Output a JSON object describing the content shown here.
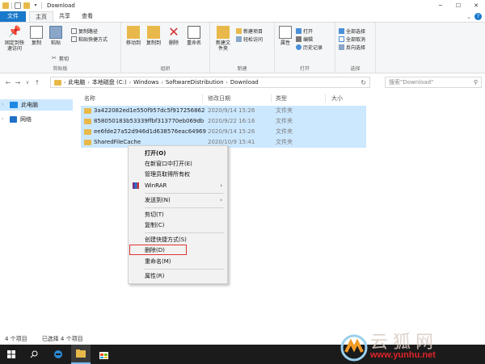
{
  "window": {
    "title": "Download"
  },
  "tabs": [
    "文件",
    "主页",
    "共享",
    "查看"
  ],
  "ribbon": {
    "clipboard": {
      "label": "剪贴板",
      "pin": "固定到快速访问",
      "copy": "复制",
      "paste": "粘贴",
      "copy_path": "复制路径",
      "paste_shortcut": "粘贴快捷方式",
      "cut": "剪切"
    },
    "organize": {
      "label": "组织",
      "move_to": "移动到",
      "copy_to": "复制到",
      "delete": "删除",
      "rename": "重命名"
    },
    "new": {
      "label": "新建",
      "new_folder": "新建文件夹",
      "new_item": "新建项目",
      "easy_access": "轻松访问"
    },
    "open": {
      "label": "打开",
      "properties": "属性",
      "open": "打开",
      "edit": "编辑",
      "history": "历史记录"
    },
    "select": {
      "label": "选择",
      "select_all": "全部选择",
      "select_none": "全部取消",
      "invert": "反向选择"
    }
  },
  "address": {
    "crumbs": [
      "此电脑",
      "本地磁盘 (C:)",
      "Windows",
      "SoftwareDistribution",
      "Download"
    ],
    "search_placeholder": "搜索\"Download\""
  },
  "sidebar": {
    "items": [
      "此电脑",
      "网络"
    ]
  },
  "columns": {
    "name": "名称",
    "date": "修改日期",
    "type": "类型",
    "size": "大小"
  },
  "files": [
    {
      "name": "3a422082ed1e550f957dc5f917256862",
      "date": "2020/9/14 15:26",
      "type": "文件夹"
    },
    {
      "name": "858050183b53339ffbf313770eb069db",
      "date": "2020/9/22 16:16",
      "type": "文件夹"
    },
    {
      "name": "ee6fde27a52d946d1d638576eac64969",
      "date": "2020/9/14 15:26",
      "type": "文件夹"
    },
    {
      "name": "SharedFileCache",
      "date": "2020/10/9 15:41",
      "type": "文件夹"
    }
  ],
  "context_menu": {
    "open": "打开(O)",
    "open_new_window": "在新窗口中打开(E)",
    "take_ownership": "管理员取得所有权",
    "winrar": "WinRAR",
    "send_to": "发送到(N)",
    "cut": "剪切(T)",
    "copy": "复制(C)",
    "create_shortcut": "创建快捷方式(S)",
    "delete": "删除(D)",
    "rename": "重命名(M)",
    "properties": "属性(R)"
  },
  "status": {
    "count": "4 个项目",
    "selected": "已选择 4 个项目"
  },
  "watermark": {
    "text": "云狐网",
    "url": "www.yunhu.net"
  },
  "colors": {
    "accent": "#1979ca",
    "selection": "#cce8ff",
    "highlight": "#e0342f",
    "taskbar": "#1b1b1b"
  }
}
